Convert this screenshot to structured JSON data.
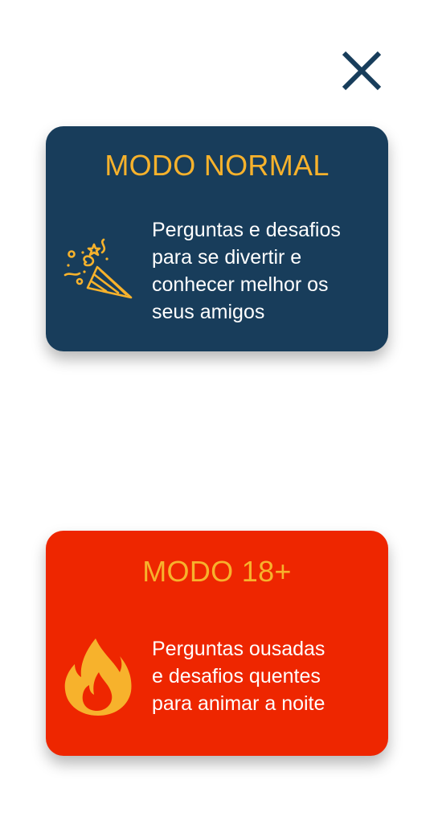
{
  "header": {
    "close_icon": "close-icon"
  },
  "modes": [
    {
      "title": "MODO NORMAL",
      "description": "Perguntas e desafios\npara se divertir e\nconhecer melhor os\nseus amigos",
      "icon": "party-popper-icon",
      "background": "#183d5b",
      "title_color": "#f7b22c"
    },
    {
      "title": "MODO 18+",
      "description": "Perguntas ousadas\ne desafios quentes\npara animar a noite",
      "icon": "flame-icon",
      "background": "#ee2600",
      "title_color": "#f7b22c"
    }
  ]
}
